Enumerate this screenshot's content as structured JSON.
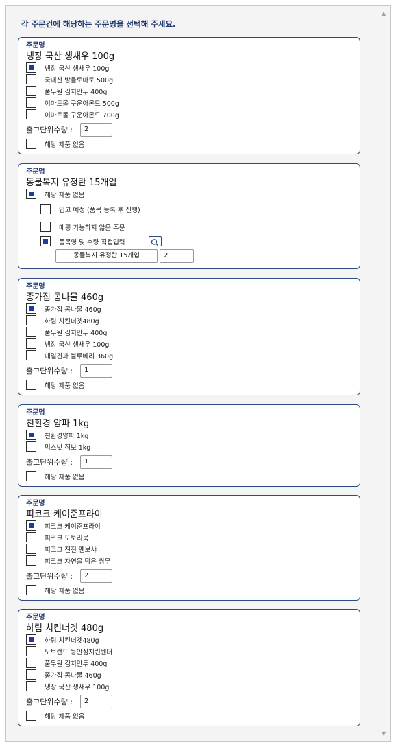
{
  "instruction": "각 주문건에 해당하는 주문명을 선택해 주세요.",
  "cards": [
    {
      "header": "주문명",
      "title": "냉장 국산 생새우 100g",
      "options": [
        {
          "label": "냉장 국산 생새우 100g",
          "checked": true
        },
        {
          "label": "국내산 방울토마토 500g",
          "checked": false
        },
        {
          "label": "풀무원 김치만두 400g",
          "checked": false
        },
        {
          "label": "이마트몰 구운아몬드 500g",
          "checked": false
        },
        {
          "label": "이마트몰 구운아몬드 700g",
          "checked": false
        }
      ],
      "qty_label": "출고단위수량 :",
      "qty_value": "2",
      "none_label": "해당 제품 없음",
      "none_checked": false
    },
    {
      "header": "주문명",
      "title": "동물복지 유정란 15개입",
      "none_label": "해당 제품 없음",
      "none_checked": true,
      "sub_options": [
        {
          "label": "입고 예정 (품목 등록 후 진행)",
          "checked": false
        },
        {
          "label": "매핑 가능하지 않은 주문",
          "checked": false
        },
        {
          "label": "품목명 및 수량 직접입력",
          "checked": true
        }
      ],
      "manual_name": "동물복지 유정란 15개입",
      "manual_qty": "2"
    },
    {
      "header": "주문명",
      "title": "종가집 콩나물 460g",
      "options": [
        {
          "label": "종가집 콩나물 460g",
          "checked": true
        },
        {
          "label": "하림 치킨너겟480g",
          "checked": false
        },
        {
          "label": "풀무원 김치만두 400g",
          "checked": false
        },
        {
          "label": "냉장 국산 생새우 100g",
          "checked": false
        },
        {
          "label": "매일견과 블루베리 360g",
          "checked": false
        }
      ],
      "qty_label": "출고단위수량 :",
      "qty_value": "1",
      "none_label": "해당 제품 없음",
      "none_checked": false
    },
    {
      "header": "주문명",
      "title": "친환경 양파 1kg",
      "options": [
        {
          "label": "친환경양파 1kg",
          "checked": true
        },
        {
          "label": "믹스넛 점보 1kg",
          "checked": false
        }
      ],
      "qty_label": "출고단위수량 :",
      "qty_value": "1",
      "none_label": "해당 제품 없음",
      "none_checked": false
    },
    {
      "header": "주문명",
      "title": "피코크 케이준프라이",
      "options": [
        {
          "label": "피코크 케이준프라이",
          "checked": true
        },
        {
          "label": "피코크 도토리묵",
          "checked": false
        },
        {
          "label": "피코크 진진 멘보샤",
          "checked": false
        },
        {
          "label": "피코크 자연을 담은 쌈무",
          "checked": false
        }
      ],
      "qty_label": "출고단위수량 :",
      "qty_value": "2",
      "none_label": "해당 제품 없음",
      "none_checked": false
    },
    {
      "header": "주문명",
      "title": "하림 치킨너겟 480g",
      "options": [
        {
          "label": "하림 치킨너겟480g",
          "checked": true
        },
        {
          "label": "노브랜드 등안심치킨텐더",
          "checked": false
        },
        {
          "label": "풀무원 김치만두 400g",
          "checked": false
        },
        {
          "label": "종가집 콩나물 460g",
          "checked": false
        },
        {
          "label": "냉장 국산 생새우 100g",
          "checked": false
        }
      ],
      "qty_label": "출고단위수량 :",
      "qty_value": "2",
      "none_label": "해당 제품 없음",
      "none_checked": false
    }
  ]
}
